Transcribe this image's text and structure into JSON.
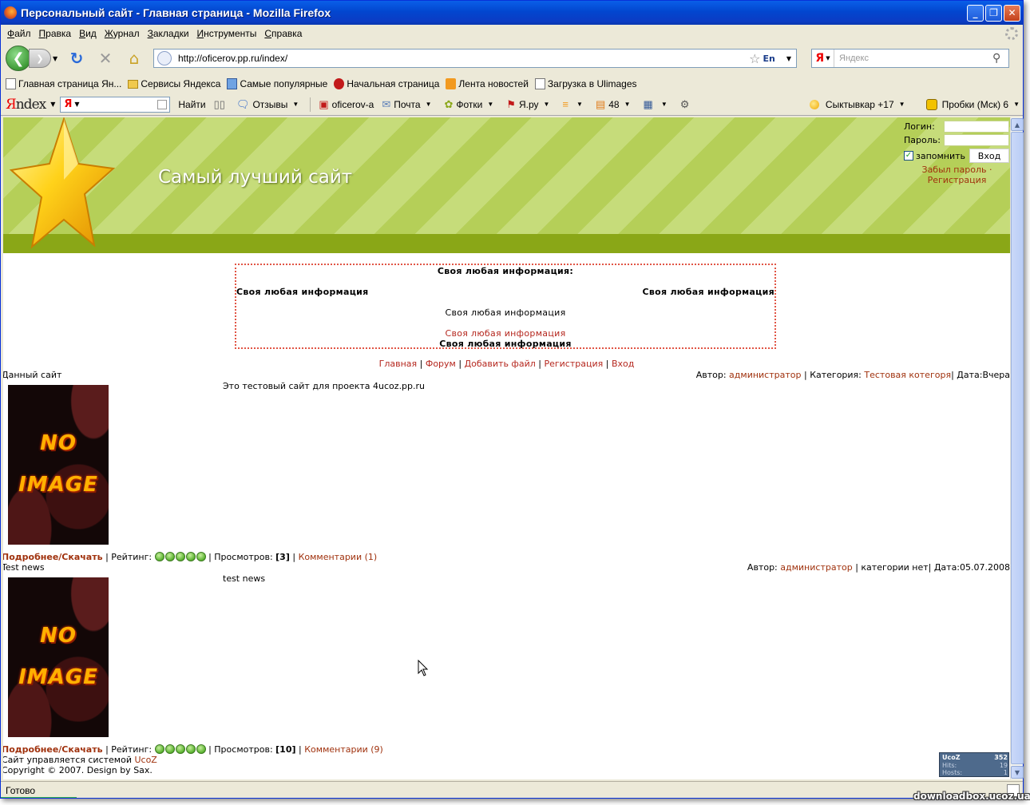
{
  "window": {
    "title": "Персональный сайт - Главная страница - Mozilla Firefox",
    "buttons": {
      "minimize": "_",
      "maximize": "❐",
      "close": "✕"
    }
  },
  "menu": [
    "Файл",
    "Правка",
    "Вид",
    "Журнал",
    "Закладки",
    "Инструменты",
    "Справка"
  ],
  "nav": {
    "url": "http://oficerov.pp.ru/index/",
    "lang": "En",
    "search_engine": "Я",
    "search_placeholder": "Яндекс"
  },
  "bookmarks": [
    {
      "label": "Главная страница Ян...",
      "icon": "page-icon"
    },
    {
      "label": "Сервисы Яндекса",
      "icon": "folder-icon"
    },
    {
      "label": "Самые популярные",
      "icon": "popular-icon"
    },
    {
      "label": "Начальная страница",
      "icon": "start-icon"
    },
    {
      "label": "Лента новостей",
      "icon": "rss-icon"
    },
    {
      "label": "Загрузка в Ulimages",
      "icon": "page-icon"
    }
  ],
  "yandex_bar": {
    "logo": "ndex",
    "logo_letter": "Я",
    "input_letter": "Я",
    "find": "Найти",
    "reviews": "Отзывы",
    "user": "oficerov-a",
    "mail": "Почта",
    "photos": "Фотки",
    "yaru": "Я.ру",
    "count": "48",
    "weather": "Сыктывкар +17",
    "traffic": "Пробки (Мск) 6"
  },
  "site": {
    "title": "Самый лучший сайт",
    "login": {
      "login_label": "Логин:",
      "password_label": "Пароль:",
      "remember": "запомнить",
      "submit": "Вход",
      "forgot": "Забыл пароль",
      "register": "Регистрация",
      "dot": "·"
    },
    "infobox": {
      "heading": "Своя любая информация:",
      "left": "Своя любая информация",
      "right": "Своя любая информация",
      "center": "Своя любая информация",
      "link": "Своя любая информация",
      "bottom": "Своя любая информация"
    },
    "nav": [
      "Главная",
      "Форум",
      "Добавить файл",
      "Регистрация",
      "Вход"
    ],
    "entries": [
      {
        "title": "Данный сайт",
        "author_label": "Автор:",
        "author": "администратор",
        "category_label": "Категория:",
        "category": "Тестовая котегоря",
        "date": "Дата:Вчера",
        "text": "Это тестовый сайт для проекта 4ucoz.pp.ru",
        "more": "Подробнее/Скачать",
        "rating_label": "Рейтинг:",
        "rating": 5,
        "views_label": "Просмотров:",
        "views": "[3]",
        "comments": "Комментарии (1)",
        "image_top": "NO",
        "image_bottom": "IMAGE"
      },
      {
        "title": "Test news",
        "author_label": "Автор:",
        "author": "администратор",
        "category_label": "",
        "category": "категории нет",
        "date": "Дата:05.07.2008",
        "text": "test news",
        "more": "Подробнее/Скачать",
        "rating_label": "Рейтинг:",
        "rating": 5,
        "views_label": "Просмотров:",
        "views": "[10]",
        "comments": "Комментарии (9)",
        "image_top": "NO",
        "image_bottom": "IMAGE"
      }
    ],
    "footer": {
      "powered": "Сайт управляется системой",
      "powered_link": "UcoZ",
      "copyright": "Copyright © 2007. Design by Sax."
    },
    "counter": {
      "brand": "UcoZ",
      "value1": "352",
      "hits": "Hits:",
      "value2": "19",
      "hosts": "Hosts:",
      "value3": "1"
    }
  },
  "status": {
    "text": "Готово"
  },
  "watermark": "downloadbox.ucoz.ua",
  "colors": {
    "link": "#a0320e",
    "header_green": "#8aa717",
    "title_bar": "#0246cf"
  }
}
